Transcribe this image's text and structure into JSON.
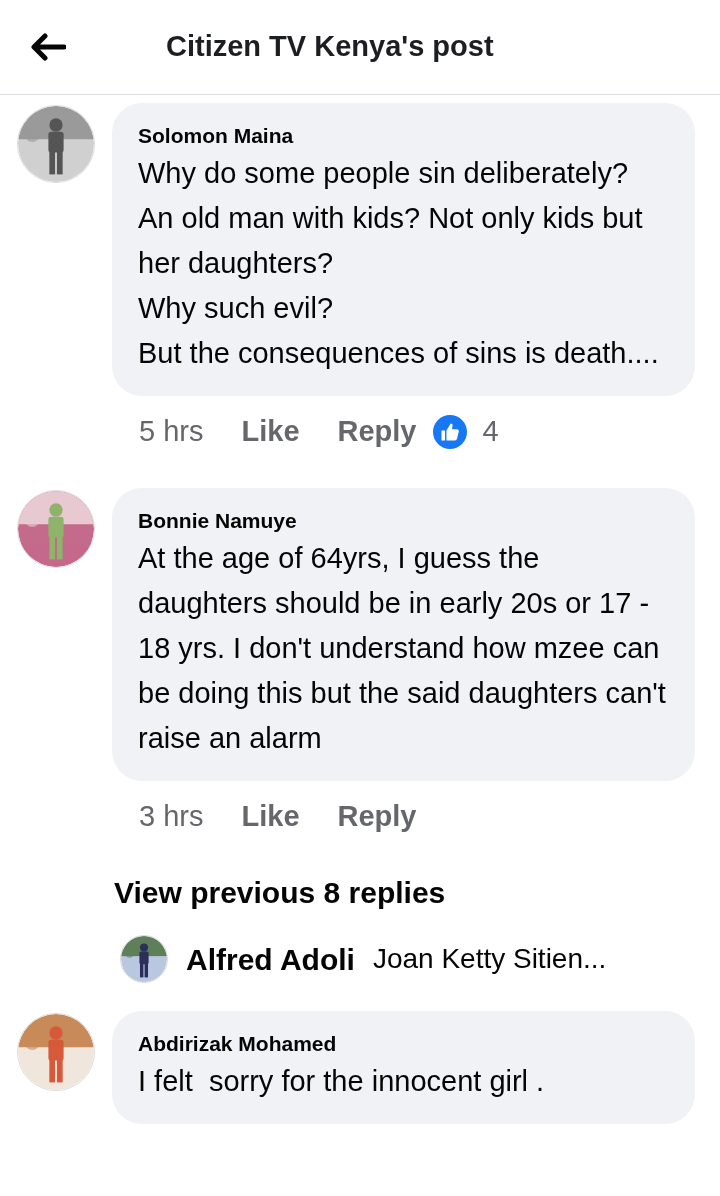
{
  "header": {
    "title": "Citizen TV Kenya's post"
  },
  "comments": [
    {
      "kind": "comment",
      "author": "Solomon Maina",
      "text": "Why do some people sin deliberately?\nAn old man with kids? Not only kids but her daughters?\nWhy such evil?\nBut the consequences of sins is death....",
      "time": "5 hrs",
      "like": "Like",
      "reply": "Reply",
      "reactions": "4"
    },
    {
      "kind": "comment",
      "author": "Bonnie Namuye",
      "text": "At the age of 64yrs, I guess the daughters should be in early 20s or 17 - 18 yrs. I don't understand how mzee can be doing this but the said daughters can't raise an alarm",
      "time": "3 hrs",
      "like": "Like",
      "reply": "Reply"
    },
    {
      "kind": "more",
      "label": "View previous 8 replies"
    },
    {
      "kind": "preview",
      "author": "Alfred Adoli",
      "text": "Joan Ketty Sitien..."
    },
    {
      "kind": "comment",
      "author": "Abdirizak Mohamed",
      "text": "I felt  sorry for the innocent girl ."
    }
  ]
}
